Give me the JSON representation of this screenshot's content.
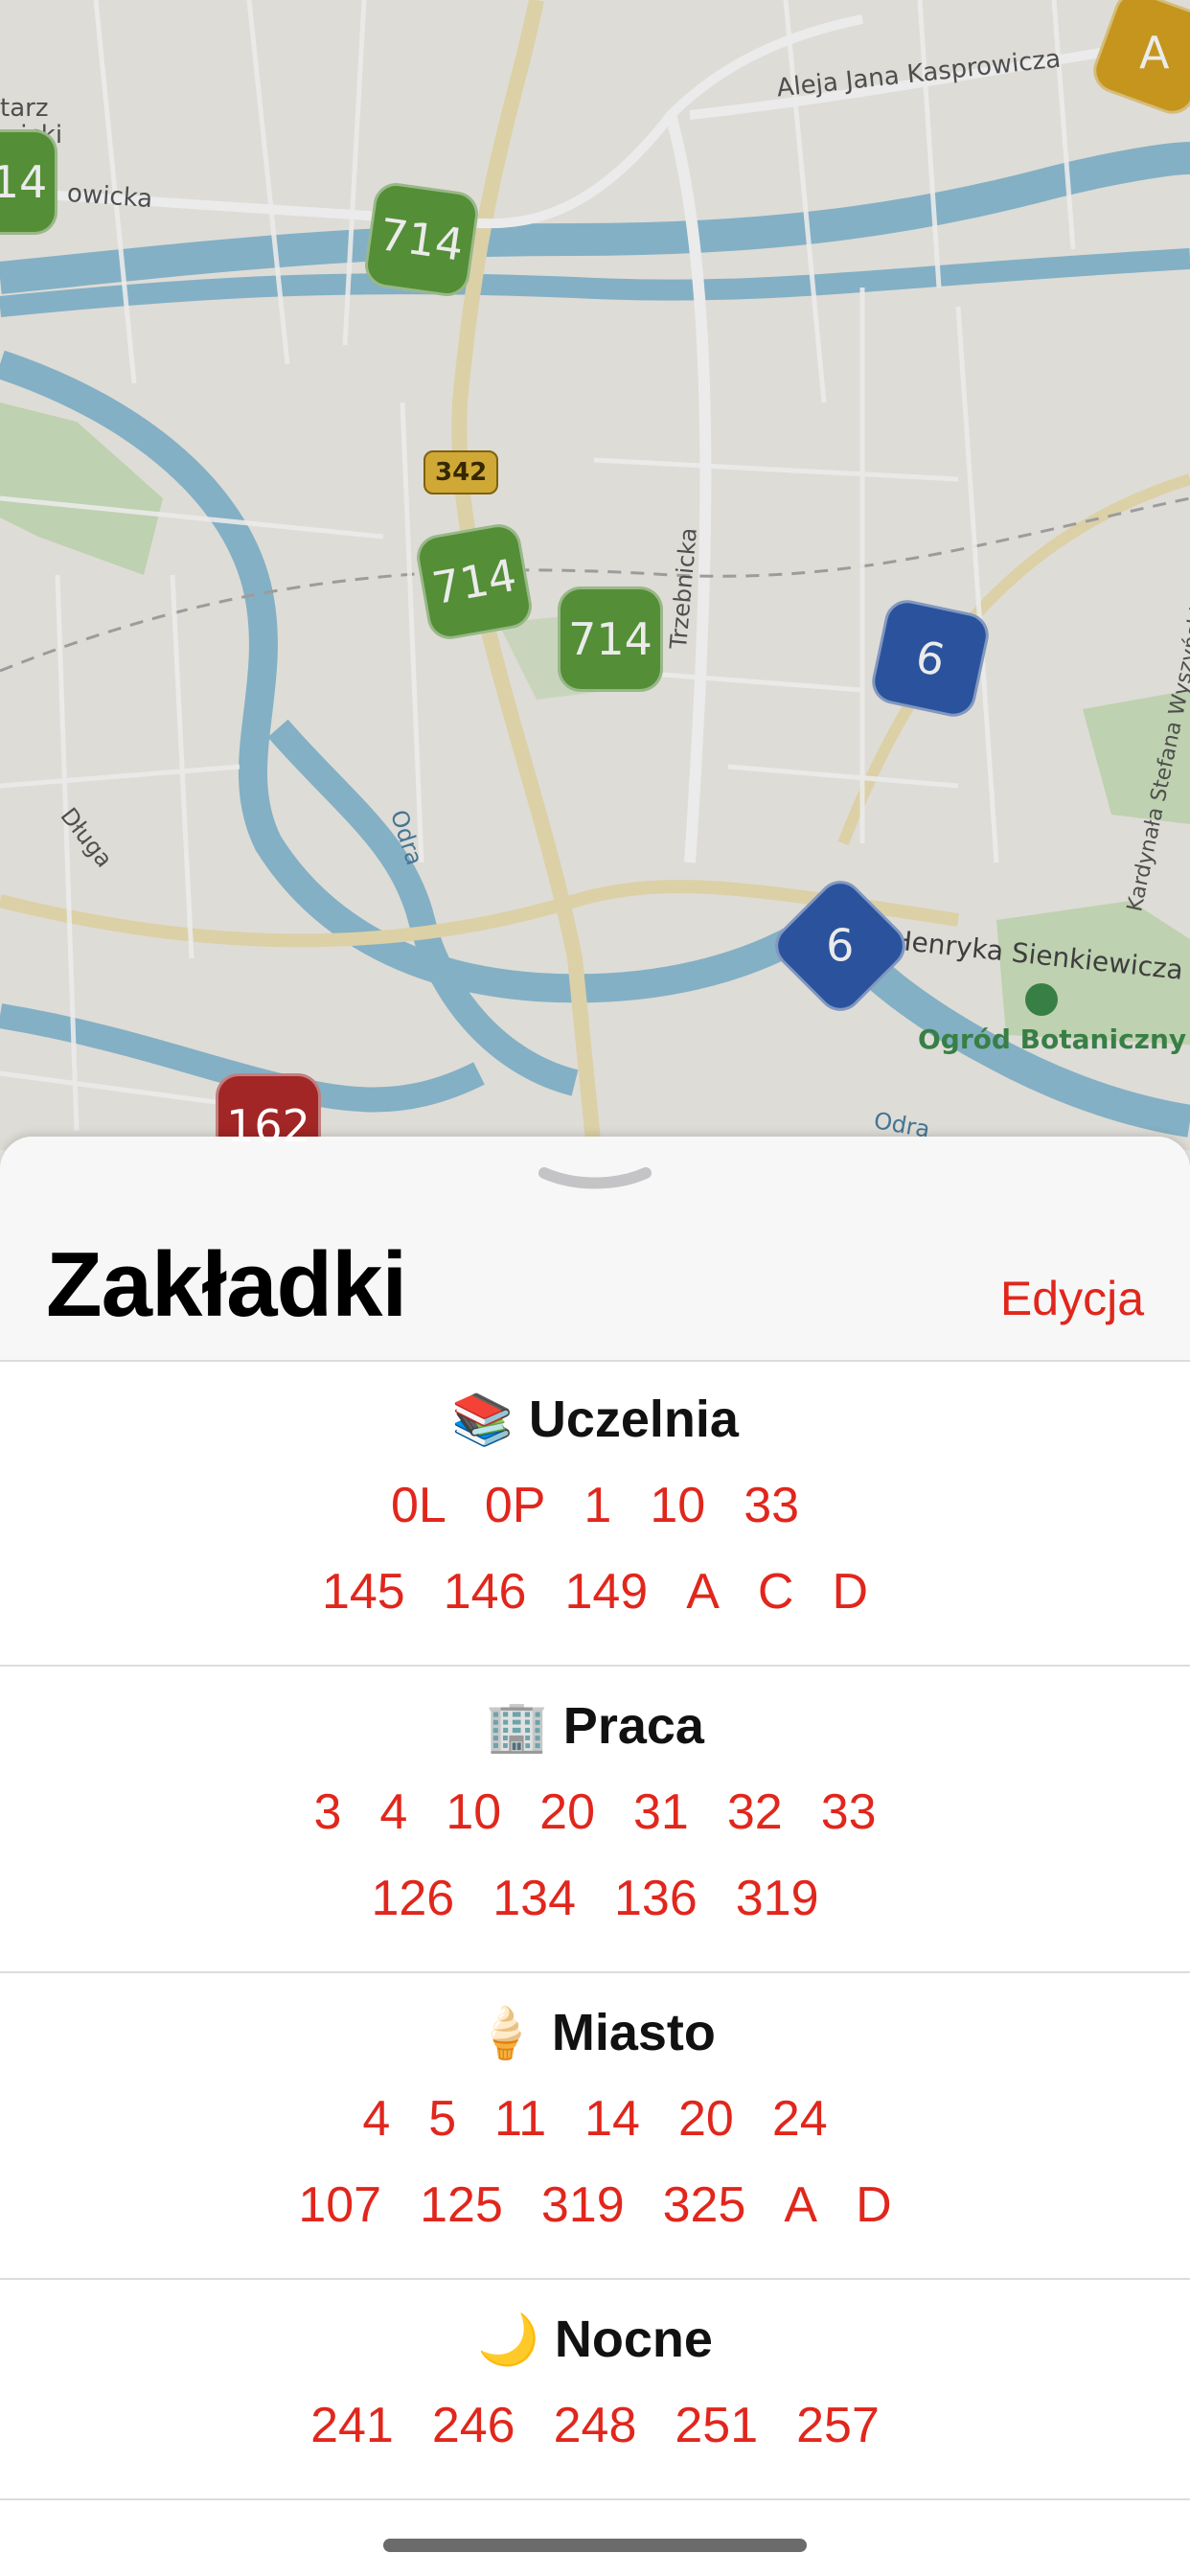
{
  "map": {
    "street_labels": [
      {
        "id": "kasprowicza",
        "text": "Aleja Jana Kasprowicza"
      },
      {
        "id": "trzebnicka",
        "text": "Trzebnicka"
      },
      {
        "id": "sienkiewicza",
        "text": "Henryka Sienkiewicza"
      },
      {
        "id": "wyszynskiego",
        "text": "Kardynała Stefana Wyszyńskiego"
      },
      {
        "id": "dluga",
        "text": "Długa"
      },
      {
        "id": "odra1",
        "text": "Odra"
      },
      {
        "id": "odra2",
        "text": "Odra"
      },
      {
        "id": "garden",
        "text": "Ogród Botaniczny"
      },
      {
        "id": "partial1",
        "text": "tarz"
      },
      {
        "id": "partial2",
        "text": "wicki"
      },
      {
        "id": "partial3",
        "text": "owicka"
      }
    ],
    "road_shield": "342",
    "markers": [
      {
        "id": "m1",
        "label": "714",
        "color": "green"
      },
      {
        "id": "m2",
        "label": "714",
        "color": "green"
      },
      {
        "id": "m3",
        "label": "714",
        "color": "green"
      },
      {
        "id": "m4",
        "label": "14",
        "color": "green"
      },
      {
        "id": "m5",
        "label": "6",
        "color": "blue"
      },
      {
        "id": "m6",
        "label": "6",
        "color": "blue"
      },
      {
        "id": "m7",
        "label": "A",
        "color": "yellow"
      },
      {
        "id": "m8",
        "label": "162",
        "color": "red"
      }
    ]
  },
  "sheet": {
    "title": "Zakładki",
    "edit_label": "Edycja",
    "groups": [
      {
        "emoji": "📚",
        "name": "Uczelnia",
        "rows": [
          [
            "0L",
            "0P",
            "1",
            "10",
            "33"
          ],
          [
            "145",
            "146",
            "149",
            "A",
            "C",
            "D"
          ]
        ]
      },
      {
        "emoji": "🏢",
        "name": "Praca",
        "rows": [
          [
            "3",
            "4",
            "10",
            "20",
            "31",
            "32",
            "33"
          ],
          [
            "126",
            "134",
            "136",
            "319"
          ]
        ]
      },
      {
        "emoji": "🍦",
        "name": "Miasto",
        "rows": [
          [
            "4",
            "5",
            "11",
            "14",
            "20",
            "24"
          ],
          [
            "107",
            "125",
            "319",
            "325",
            "A",
            "D"
          ]
        ]
      },
      {
        "emoji": "🌙",
        "name": "Nocne",
        "rows": [
          [
            "241",
            "246",
            "248",
            "251",
            "257"
          ]
        ]
      }
    ]
  },
  "colors": {
    "accent": "#e1261c",
    "marker_green": "#5c9b3c",
    "marker_blue": "#2f5bab",
    "marker_red": "#b02a2a",
    "marker_yellow": "#d6a220",
    "river": "#8fbfd6"
  }
}
